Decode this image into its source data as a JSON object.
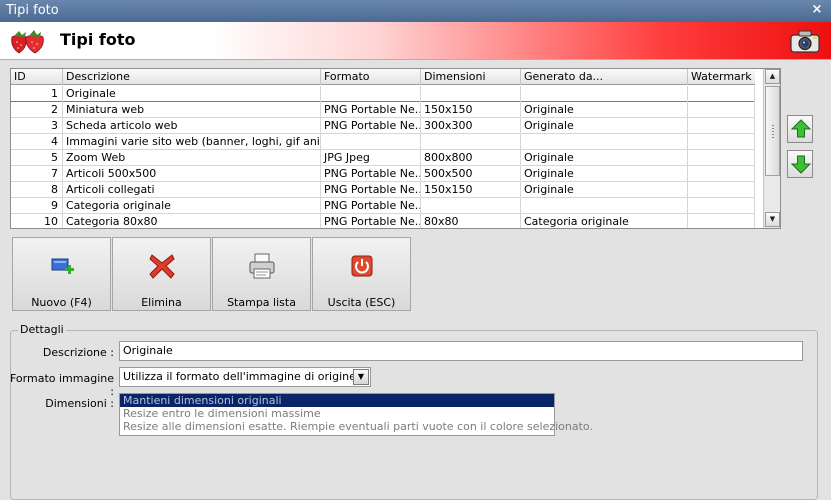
{
  "window": {
    "title": "Tipi foto",
    "close_glyph": "×"
  },
  "header": {
    "title": "Tipi foto",
    "logo_icon": "strawberries-icon",
    "right_icon": "camera-icon"
  },
  "grid": {
    "columns": [
      "ID",
      "Descrizione",
      "Formato",
      "Dimensioni",
      "Generato da...",
      "Watermark"
    ],
    "rows": [
      {
        "id": "1",
        "descrizione": "Originale",
        "formato": "",
        "dimensioni": "",
        "generato": "",
        "watermark": ""
      },
      {
        "id": "2",
        "descrizione": "Miniatura web",
        "formato": "PNG Portable Ne...",
        "dimensioni": "150x150",
        "generato": "Originale",
        "watermark": ""
      },
      {
        "id": "3",
        "descrizione": "Scheda articolo web",
        "formato": "PNG Portable Ne...",
        "dimensioni": "300x300",
        "generato": "Originale",
        "watermark": ""
      },
      {
        "id": "4",
        "descrizione": "Immagini varie sito web (banner, loghi, gif animat...",
        "formato": "",
        "dimensioni": "",
        "generato": "",
        "watermark": ""
      },
      {
        "id": "5",
        "descrizione": "Zoom Web",
        "formato": "JPG Jpeg",
        "dimensioni": "800x800",
        "generato": "Originale",
        "watermark": ""
      },
      {
        "id": "7",
        "descrizione": "Articoli 500x500",
        "formato": "PNG Portable Ne...",
        "dimensioni": "500x500",
        "generato": "Originale",
        "watermark": ""
      },
      {
        "id": "8",
        "descrizione": "Articoli collegati",
        "formato": "PNG Portable Ne...",
        "dimensioni": "150x150",
        "generato": "Originale",
        "watermark": ""
      },
      {
        "id": "9",
        "descrizione": "Categoria originale",
        "formato": "PNG Portable Ne...",
        "dimensioni": "",
        "generato": "",
        "watermark": ""
      },
      {
        "id": "10",
        "descrizione": "Categoria 80x80",
        "formato": "PNG Portable Ne...",
        "dimensioni": "80x80",
        "generato": "Categoria originale",
        "watermark": ""
      }
    ],
    "selected_row_index": 0
  },
  "side_buttons": {
    "up_icon": "arrow-up-icon",
    "down_icon": "arrow-down-icon"
  },
  "toolbar": {
    "new_label": "Nuovo (F4)",
    "delete_label": "Elimina",
    "print_label": "Stampa lista",
    "exit_label": "Uscita (ESC)"
  },
  "details": {
    "legend": "Dettagli",
    "descrizione_label": "Descrizione :",
    "descrizione_value": "Originale",
    "formato_label": "Formato immagine :",
    "formato_value": "Utilizza il formato dell'immagine di origine",
    "dimensioni_label": "Dimensioni :",
    "dimensioni_options": [
      "Mantieni dimensioni originali",
      "Resize entro le dimensioni massime",
      "Resize alle dimensioni esatte. Riempie eventuali parti vuote con il colore selezionato."
    ],
    "dimensioni_selected_index": 0
  },
  "colors": {
    "titlebar": "#4b6a92",
    "header_accent": "#ee1010",
    "selection": "#0a246a"
  }
}
